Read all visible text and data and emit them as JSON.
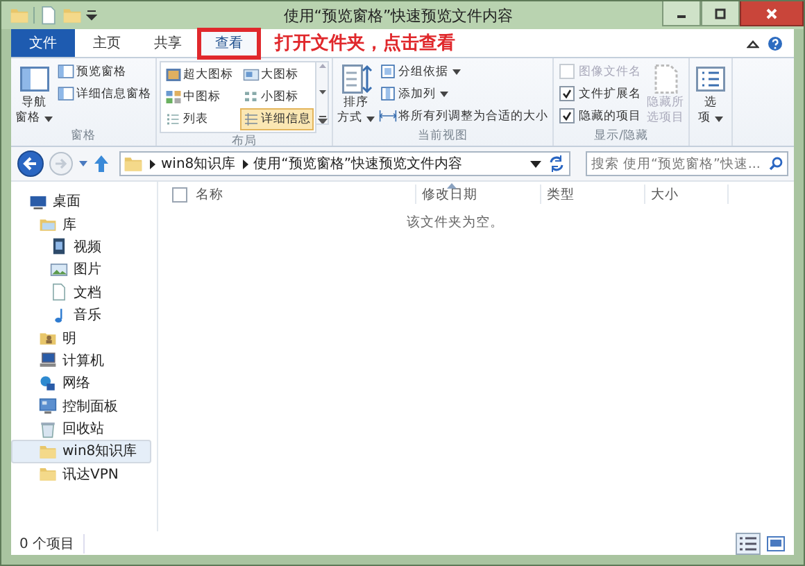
{
  "window": {
    "title": "使用“预览窗格”快速预览文件内容"
  },
  "tabs": [
    {
      "label": "文件",
      "kind": "file",
      "selected": false,
      "highlighted": false
    },
    {
      "label": "主页",
      "kind": "tab",
      "selected": false,
      "highlighted": false
    },
    {
      "label": "共享",
      "kind": "tab",
      "selected": false,
      "highlighted": false
    },
    {
      "label": "查看",
      "kind": "tab",
      "selected": true,
      "highlighted": true
    }
  ],
  "annotation": {
    "text": "打开文件夹，点击查看"
  },
  "ribbon": {
    "groups": [
      {
        "label": "窗格",
        "items": [
          {
            "kind": "large",
            "lines": [
              "导航",
              "窗格"
            ],
            "dropdown": true
          },
          {
            "kind": "small",
            "label": "预览窗格"
          },
          {
            "kind": "small",
            "label": "详细信息窗格"
          }
        ]
      },
      {
        "label": "布局",
        "items": [
          {
            "kind": "gallery",
            "options": [
              {
                "label": "超大图标",
                "selected": false
              },
              {
                "label": "大图标",
                "selected": false
              },
              {
                "label": "中图标",
                "selected": false
              },
              {
                "label": "小图标",
                "selected": false
              },
              {
                "label": "列表",
                "selected": false
              },
              {
                "label": "详细信息",
                "selected": true
              }
            ]
          }
        ]
      },
      {
        "label": "当前视图",
        "items": [
          {
            "kind": "large",
            "lines": [
              "排序",
              "方式"
            ],
            "dropdown": true
          },
          {
            "kind": "small",
            "label": "分组依据",
            "dropdown": true
          },
          {
            "kind": "small",
            "label": "添加列",
            "dropdown": true
          },
          {
            "kind": "small",
            "label": "将所有列调整为合适的大小"
          }
        ]
      },
      {
        "label": "显示/隐藏",
        "items": [
          {
            "kind": "check",
            "label": "图像文件名",
            "checked": false,
            "disabled": true
          },
          {
            "kind": "check",
            "label": "文件扩展名",
            "checked": true,
            "disabled": false
          },
          {
            "kind": "check",
            "label": "隐藏的项目",
            "checked": true,
            "disabled": false
          },
          {
            "kind": "large",
            "lines": [
              "隐藏所",
              "选项目"
            ],
            "disabled": true
          }
        ]
      },
      {
        "items": [
          {
            "kind": "large",
            "lines": [
              "选",
              "项"
            ],
            "dropdown": true
          }
        ]
      }
    ]
  },
  "address": {
    "path": [
      "win8知识库",
      "使用“预览窗格”快速预览文件内容"
    ],
    "search_placeholder": "搜索 使用“预览窗格”快速..."
  },
  "nav_tree": [
    {
      "label": "桌面",
      "kind": "desktop",
      "selected": false,
      "children": [
        {
          "label": "库",
          "kind": "library",
          "selected": false,
          "children": [
            {
              "label": "视频",
              "kind": "video",
              "selected": false
            },
            {
              "label": "图片",
              "kind": "image",
              "selected": false
            },
            {
              "label": "文档",
              "kind": "document",
              "selected": false
            },
            {
              "label": "音乐",
              "kind": "music",
              "selected": false
            }
          ]
        },
        {
          "label": "明",
          "kind": "user",
          "selected": false
        },
        {
          "label": "计算机",
          "kind": "computer",
          "selected": false
        },
        {
          "label": "网络",
          "kind": "network",
          "selected": false
        },
        {
          "label": "控制面板",
          "kind": "control",
          "selected": false
        },
        {
          "label": "回收站",
          "kind": "bin",
          "selected": false
        },
        {
          "label": "win8知识库",
          "kind": "folder",
          "selected": true
        },
        {
          "label": "讯达VPN",
          "kind": "folder",
          "selected": false
        }
      ]
    }
  ],
  "file_list": {
    "select_all_checked": false,
    "columns": [
      "名称",
      "修改日期",
      "类型",
      "大小"
    ],
    "empty_message": "该文件夹为空。"
  },
  "status_bar": {
    "count": "0 个项目",
    "views": [
      {
        "kind": "details",
        "selected": true
      },
      {
        "kind": "large-icons",
        "selected": false
      }
    ]
  }
}
